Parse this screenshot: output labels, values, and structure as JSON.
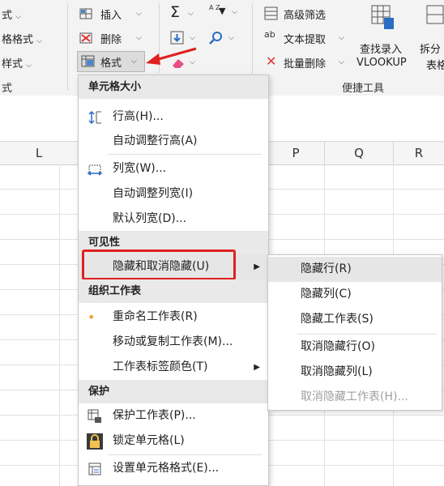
{
  "ribbon": {
    "left_items": [
      "式",
      "格格式",
      "样式",
      "式"
    ],
    "insert_label": "插入",
    "delete_label": "删除",
    "format_label": "格式",
    "sigma": "Σ",
    "sort_label": "A Z",
    "advanced_filter": "高级筛选",
    "text_extract": "文本提取",
    "batch_delete": "批量删除",
    "lookup_line1": "查找录入",
    "lookup_line2": "VLOOKUP",
    "split_line1": "拆分",
    "split_line2": "表格",
    "group_convenient": "便捷工具"
  },
  "columns": [
    "L",
    "P",
    "Q",
    "R"
  ],
  "menu": {
    "section_cell_size": "单元格大小",
    "row_height": "行高(H)...",
    "autofit_row": "自动调整行高(A)",
    "col_width": "列宽(W)...",
    "autofit_col": "自动调整列宽(I)",
    "default_width": "默认列宽(D)...",
    "section_visibility": "可见性",
    "hide_unhide": "隐藏和取消隐藏(U)",
    "section_organize": "组织工作表",
    "rename": "重命名工作表(R)",
    "move_copy": "移动或复制工作表(M)...",
    "tab_color": "工作表标签颜色(T)",
    "section_protect": "保护",
    "protect_sheet": "保护工作表(P)...",
    "lock_cell": "锁定单元格(L)",
    "format_cells": "设置单元格格式(E)..."
  },
  "submenu": {
    "hide_rows": "隐藏行(R)",
    "hide_cols": "隐藏列(C)",
    "hide_sheet": "隐藏工作表(S)",
    "unhide_rows": "取消隐藏行(O)",
    "unhide_cols": "取消隐藏列(L)",
    "unhide_sheet": "取消隐藏工作表(H)..."
  },
  "colors": {
    "annotation_red": "#e02020",
    "accent_blue": "#2b6cc4",
    "disabled_text": "#a0a0a0"
  }
}
